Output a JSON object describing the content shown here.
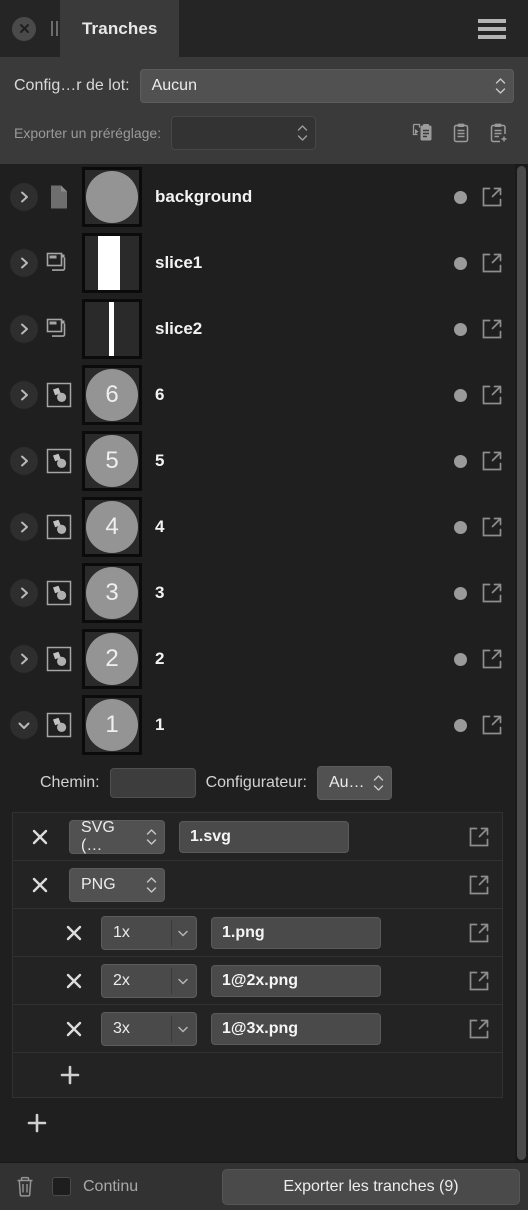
{
  "titlebar": {
    "close_icon": "close-circle-icon",
    "grip_icon": "pause-grip-icon",
    "tab_label": "Tranches",
    "menu_icon": "hamburger-menu-icon"
  },
  "options": {
    "batch_label": "Config…r de lot:",
    "batch_value": "Aucun",
    "preset_label": "Exporter un préréglage:",
    "preset_value": "",
    "preset_placeholder": "",
    "actions": [
      {
        "name": "apply-preset-icon",
        "title": "apply-preset"
      },
      {
        "name": "copy-preset-icon",
        "title": "copy-preset"
      },
      {
        "name": "add-preset-icon",
        "title": "add-preset"
      }
    ]
  },
  "list": {
    "rows": [
      {
        "name": "background",
        "type": "page",
        "expanded": false,
        "thumb": "page-speckle",
        "badge": ""
      },
      {
        "name": "slice1",
        "type": "slice",
        "expanded": false,
        "thumb": "bar-wide",
        "badge": ""
      },
      {
        "name": "slice2",
        "type": "slice",
        "expanded": false,
        "thumb": "bar-narrow",
        "badge": ""
      },
      {
        "name": "6",
        "type": "symbol",
        "expanded": false,
        "thumb": "circle",
        "badge": "6"
      },
      {
        "name": "5",
        "type": "symbol",
        "expanded": false,
        "thumb": "circle",
        "badge": "5"
      },
      {
        "name": "4",
        "type": "symbol",
        "expanded": false,
        "thumb": "circle",
        "badge": "4"
      },
      {
        "name": "3",
        "type": "symbol",
        "expanded": false,
        "thumb": "circle",
        "badge": "3"
      },
      {
        "name": "2",
        "type": "symbol",
        "expanded": false,
        "thumb": "circle",
        "badge": "2"
      },
      {
        "name": "1",
        "type": "symbol",
        "expanded": true,
        "thumb": "circle",
        "badge": "1"
      }
    ]
  },
  "detail": {
    "path_label": "Chemin:",
    "path_value": "",
    "configurator_label": "Configurateur:",
    "configurator_value": "Au…",
    "exports": [
      {
        "format": "SVG (…",
        "filename": "1.svg",
        "scale": null
      },
      {
        "format": "PNG",
        "filename": "",
        "scale": null
      }
    ],
    "png_scales": [
      {
        "scale": "1x",
        "filename": "1.png"
      },
      {
        "scale": "2x",
        "filename": "1@2x.png"
      },
      {
        "scale": "3x",
        "filename": "1@3x.png"
      }
    ],
    "add_export_label": "+",
    "add_slice_label": "+"
  },
  "bottombar": {
    "trash_icon": "trash-icon",
    "continuous_label": "Continu",
    "continuous_checked": false,
    "export_button_label": "Exporter les tranches (9)"
  },
  "colors": {
    "panel": "#3a3a3a",
    "list_bg": "#1f1f1f",
    "titlebar": "#252525",
    "accent_text": "#f2f2f2",
    "thumb_circle": "#949494",
    "status_dot": "#9a9a9a"
  }
}
